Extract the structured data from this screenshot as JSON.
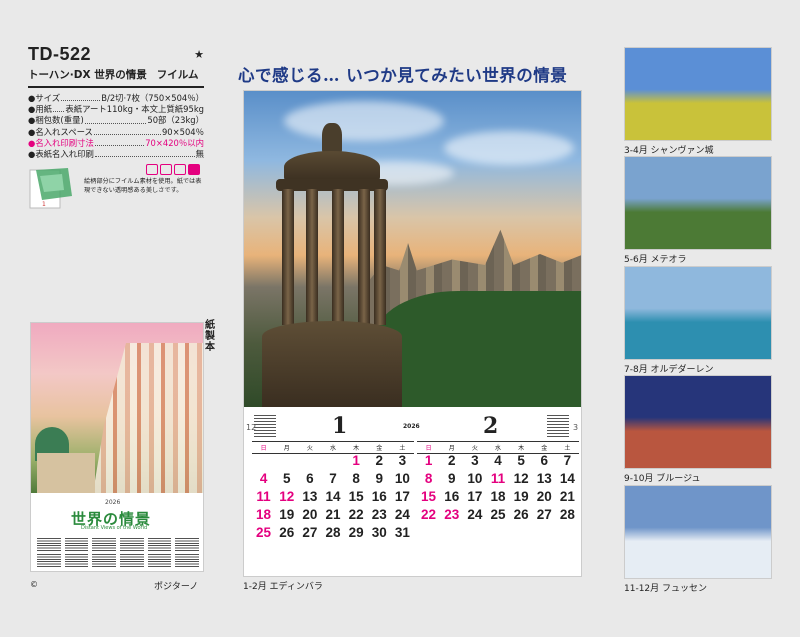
{
  "product": {
    "code": "TD-522",
    "star": "★",
    "name": "トーハン·DX 世界の情景",
    "type": "フイルム",
    "specs": [
      {
        "label": "サイズ",
        "value": "B/2切·7枚（750×504％）",
        "pink": false
      },
      {
        "label": "用紙",
        "value": "表紙アート110kg・本文上質紙95kg",
        "pink": false
      },
      {
        "label": "梱包数(重量)",
        "value": "50部（23kg）",
        "pink": false
      },
      {
        "label": "名入れスペース",
        "value": "90×504％",
        "pink": false
      },
      {
        "label": "名入れ印刷寸法",
        "value": "70×420％以内",
        "pink": true
      },
      {
        "label": "表紙名入れ印刷",
        "value": "無",
        "pink": false
      }
    ],
    "film_note": "絵柄部分にフイルム素材を使用。紙では表現できない透明感ある美しさです。"
  },
  "cover": {
    "year": "2026",
    "title": "世界の情景",
    "subtitle": "Distant Views of the World",
    "material_label": "紙製本",
    "caption": "ポジターノ",
    "copyright": "©"
  },
  "main": {
    "headline": "心で感じる… いつか見てみたい世界の情景",
    "caption": "1-2月 エディンバラ",
    "year": "2026",
    "weekdays": [
      "日",
      "月",
      "火",
      "水",
      "木",
      "金",
      "土"
    ],
    "months": [
      {
        "number": "1",
        "mini_left": "12",
        "days": [
          {
            "d": "",
            "r": false
          },
          {
            "d": "",
            "r": false
          },
          {
            "d": "",
            "r": false
          },
          {
            "d": "",
            "r": false
          },
          {
            "d": "1",
            "r": true
          },
          {
            "d": "2",
            "r": false
          },
          {
            "d": "3",
            "r": false
          },
          {
            "d": "4",
            "r": true
          },
          {
            "d": "5",
            "r": false
          },
          {
            "d": "6",
            "r": false
          },
          {
            "d": "7",
            "r": false
          },
          {
            "d": "8",
            "r": false
          },
          {
            "d": "9",
            "r": false
          },
          {
            "d": "10",
            "r": false
          },
          {
            "d": "11",
            "r": true
          },
          {
            "d": "12",
            "r": true
          },
          {
            "d": "13",
            "r": false
          },
          {
            "d": "14",
            "r": false
          },
          {
            "d": "15",
            "r": false
          },
          {
            "d": "16",
            "r": false
          },
          {
            "d": "17",
            "r": false
          },
          {
            "d": "18",
            "r": true
          },
          {
            "d": "19",
            "r": false
          },
          {
            "d": "20",
            "r": false
          },
          {
            "d": "21",
            "r": false
          },
          {
            "d": "22",
            "r": false
          },
          {
            "d": "23",
            "r": false
          },
          {
            "d": "24",
            "r": false
          },
          {
            "d": "25",
            "r": true
          },
          {
            "d": "26",
            "r": false
          },
          {
            "d": "27",
            "r": false
          },
          {
            "d": "28",
            "r": false
          },
          {
            "d": "29",
            "r": false
          },
          {
            "d": "30",
            "r": false
          },
          {
            "d": "31",
            "r": false
          }
        ]
      },
      {
        "number": "2",
        "mini_right": "3",
        "days": [
          {
            "d": "1",
            "r": true
          },
          {
            "d": "2",
            "r": false
          },
          {
            "d": "3",
            "r": false
          },
          {
            "d": "4",
            "r": false
          },
          {
            "d": "5",
            "r": false
          },
          {
            "d": "6",
            "r": false
          },
          {
            "d": "7",
            "r": false
          },
          {
            "d": "8",
            "r": true
          },
          {
            "d": "9",
            "r": false
          },
          {
            "d": "10",
            "r": false
          },
          {
            "d": "11",
            "r": true
          },
          {
            "d": "12",
            "r": false
          },
          {
            "d": "13",
            "r": false
          },
          {
            "d": "14",
            "r": false
          },
          {
            "d": "15",
            "r": true
          },
          {
            "d": "16",
            "r": false
          },
          {
            "d": "17",
            "r": false
          },
          {
            "d": "18",
            "r": false
          },
          {
            "d": "19",
            "r": false
          },
          {
            "d": "20",
            "r": false
          },
          {
            "d": "21",
            "r": false
          },
          {
            "d": "22",
            "r": true
          },
          {
            "d": "23",
            "r": true
          },
          {
            "d": "24",
            "r": false
          },
          {
            "d": "25",
            "r": false
          },
          {
            "d": "26",
            "r": false
          },
          {
            "d": "27",
            "r": false
          },
          {
            "d": "28",
            "r": false
          }
        ]
      }
    ]
  },
  "pages": [
    {
      "caption": "3-4月 シャンヴァン城",
      "sky": "#5b8fd6",
      "ground": "#c9c23a"
    },
    {
      "caption": "5-6月 メテオラ",
      "sky": "#7aa3cf",
      "ground": "#4c7a35"
    },
    {
      "caption": "7-8月 オルデダーレン",
      "sky": "#8fb8dd",
      "ground": "#2d8fb0"
    },
    {
      "caption": "9-10月 ブルージュ",
      "sky": "#26357a",
      "ground": "#b9563f"
    },
    {
      "caption": "11-12月 フュッセン",
      "sky": "#6f95c9",
      "ground": "#e6edf4"
    }
  ],
  "colors": {
    "accent": "#e4007f",
    "headline": "#1f3a86"
  }
}
